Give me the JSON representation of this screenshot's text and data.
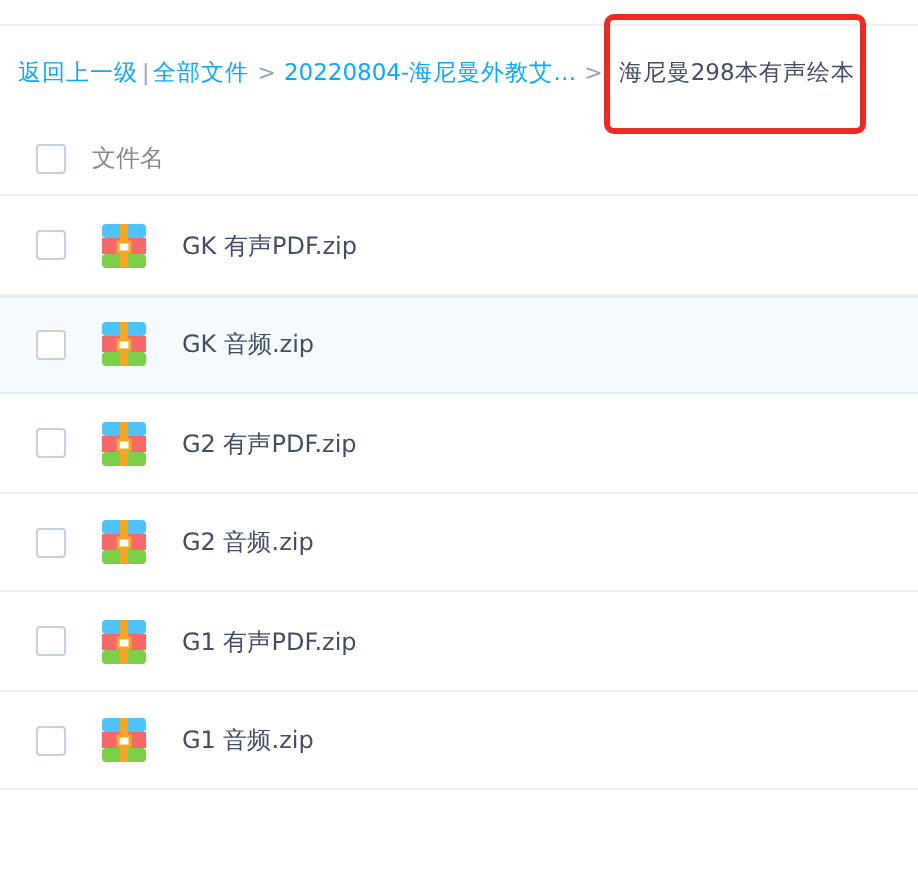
{
  "breadcrumb": [
    {
      "kind": "link",
      "label": "返回上一级",
      "separator_after": "|"
    },
    {
      "kind": "link",
      "label": "全部文件",
      "separator_after": ">"
    },
    {
      "kind": "link",
      "label": "20220804-海尼曼外教艾…",
      "separator_after": ">"
    },
    {
      "kind": "current",
      "label": "海尼曼298本有声绘本",
      "outlined": true
    }
  ],
  "header": {
    "checked": false,
    "label": "文件名"
  },
  "files": [
    {
      "name": "GK 有声PDF.zip",
      "checked": false,
      "hovered": false
    },
    {
      "name": "GK 音频.zip",
      "checked": false,
      "hovered": true
    },
    {
      "name": "G2 有声PDF.zip",
      "checked": false,
      "hovered": false
    },
    {
      "name": "G2 音频.zip",
      "checked": false,
      "hovered": false
    },
    {
      "name": "G1 有声PDF.zip",
      "checked": false,
      "hovered": false
    },
    {
      "name": "G1 音频.zip",
      "checked": false,
      "hovered": false
    }
  ]
}
